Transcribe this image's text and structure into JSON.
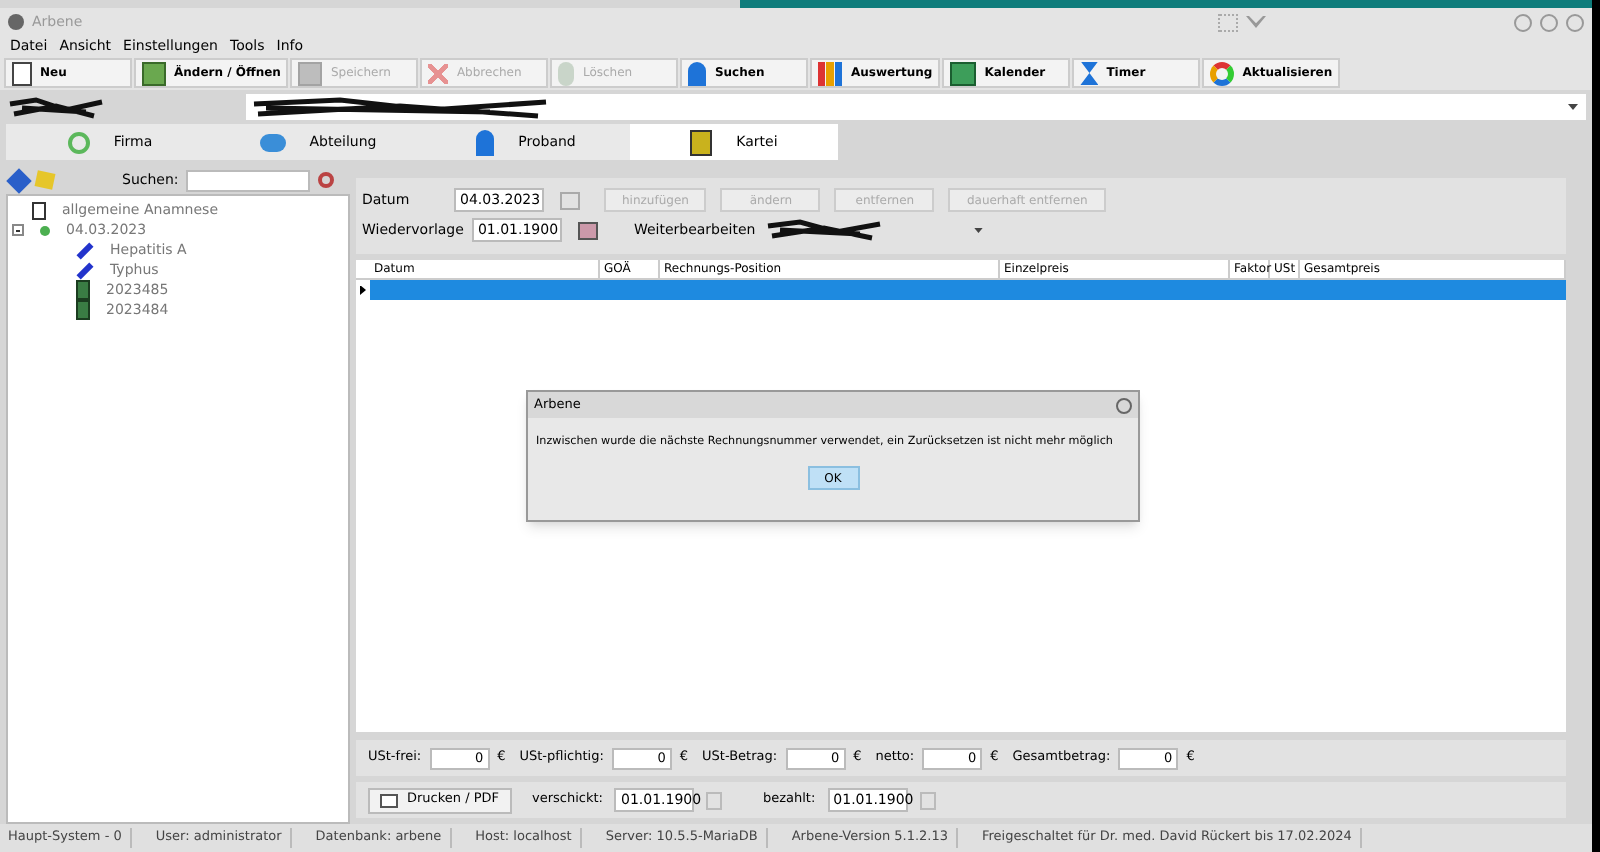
{
  "window": {
    "title": "Arbene"
  },
  "menu": [
    "Datei",
    "Ansicht",
    "Einstellungen",
    "Tools",
    "Info"
  ],
  "toolbar": [
    {
      "label": "Neu",
      "disabled": false
    },
    {
      "label": "Ändern / Öffnen",
      "disabled": false
    },
    {
      "label": "Speichern",
      "disabled": true
    },
    {
      "label": "Abbrechen",
      "disabled": true
    },
    {
      "label": "Löschen",
      "disabled": true
    },
    {
      "label": "Suchen",
      "disabled": false
    },
    {
      "label": "Auswertung",
      "disabled": false
    },
    {
      "label": "Kalender",
      "disabled": false
    },
    {
      "label": "Timer",
      "disabled": false
    },
    {
      "label": "Aktualisieren",
      "disabled": false
    }
  ],
  "tabs": [
    {
      "label": "Firma",
      "selected": false
    },
    {
      "label": "Abteilung",
      "selected": false
    },
    {
      "label": "Proband",
      "selected": false
    },
    {
      "label": "Kartei",
      "selected": true
    }
  ],
  "sidebar": {
    "search_label": "Suchen:",
    "tree": [
      {
        "kind": "document",
        "label": "allgemeine Anamnese"
      },
      {
        "kind": "date",
        "label": "04.03.2023",
        "expanded": true,
        "children": [
          {
            "kind": "vaccine",
            "label": "Hepatitis A"
          },
          {
            "kind": "vaccine",
            "label": "Typhus"
          },
          {
            "kind": "invoice",
            "label": "2023485"
          },
          {
            "kind": "invoice",
            "label": "2023484"
          }
        ]
      }
    ]
  },
  "form": {
    "date_label": "Datum",
    "date": "04.03.2023",
    "buttons": [
      {
        "label": "hinzufügen",
        "disabled": true
      },
      {
        "label": "ändern",
        "disabled": true
      },
      {
        "label": "entfernen",
        "disabled": true
      },
      {
        "label": "dauerhaft entfernen",
        "disabled": true
      }
    ],
    "resubmission_label": "Wiedervorlage",
    "resubmission": "01.01.1900",
    "continue_label": "Weiterbearbeiten"
  },
  "table": {
    "columns": [
      "Datum",
      "GOÄ",
      "Rechnungs-Position",
      "Einzelpreis",
      "Faktor",
      "USt",
      "Gesamtpreis"
    ],
    "rows": [
      {
        "selected": true
      }
    ]
  },
  "totals": [
    {
      "label": "USt-frei:",
      "value": "0",
      "unit": "€"
    },
    {
      "label": "USt-pflichtig:",
      "value": "0",
      "unit": "€"
    },
    {
      "label": "USt-Betrag:",
      "value": "0",
      "unit": "€"
    },
    {
      "label": "netto:",
      "value": "0",
      "unit": "€"
    },
    {
      "label": "Gesamtbetrag:",
      "value": "0",
      "unit": "€"
    }
  ],
  "print_row": {
    "button": "Drucken / PDF",
    "sent_label": "verschickt:",
    "sent": "01.01.1900",
    "paid_label": "bezahlt:",
    "paid": "01.01.1900"
  },
  "dialog": {
    "title": "Arbene",
    "message": "Inzwischen wurde die nächste Rechnungsnummer verwendet, ein Zurücksetzen ist nicht mehr möglich",
    "button": "OK"
  },
  "status_bar": [
    "Haupt-System - 0",
    "User: administrator",
    "Datenbank: arbene",
    "Host: localhost",
    "Server: 10.5.5-MariaDB",
    "Arbene-Version 5.1.2.13",
    "Freigeschaltet für Dr. med. David Rückert bis 17.02.2024"
  ]
}
